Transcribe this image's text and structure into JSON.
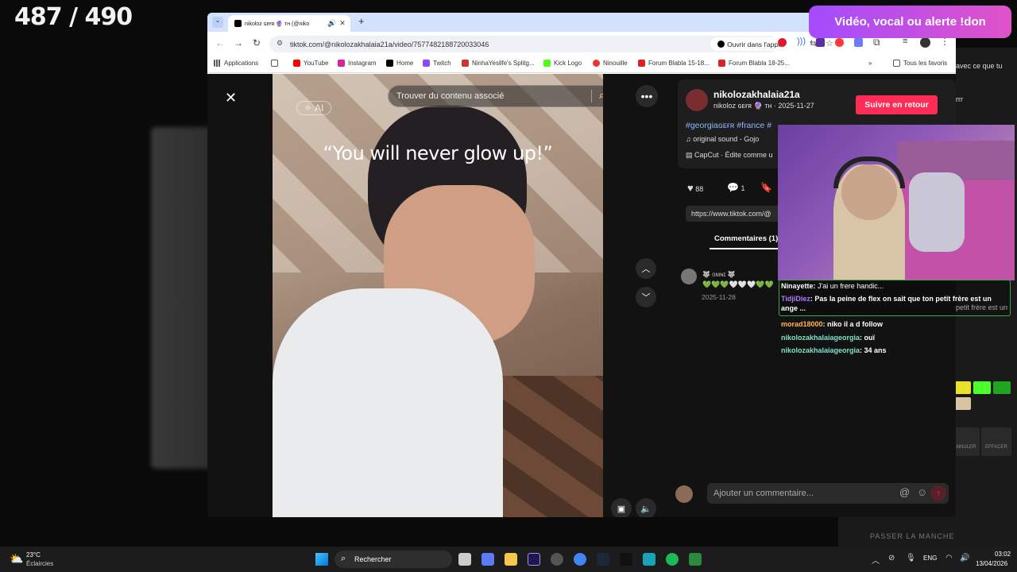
{
  "counter": "487 / 490",
  "alert": "Vidéo, vocal ou alerte !don",
  "browser": {
    "tab_title": "nikoloz ɢᴇғʀ 🔮 ᴛʜ (@niko",
    "url": "tiktok.com/@nikolozakhalaia21a/video/7577482188720033046",
    "open_app": "Ouvrir dans l'appli",
    "bookmarks": [
      "Applications",
      "YouTube",
      "Instagram",
      "Home",
      "Twitch",
      "NinhaYeslife's Splitg...",
      "Kick Logo",
      "Ninouille",
      "Forum Blabla 15-18...",
      "Forum Blabla 18-25...",
      "Tous les favoris"
    ]
  },
  "video": {
    "search_placeholder": "Trouver du contenu associé",
    "ai_badge": "AI",
    "caption": "“You will never glow up!”"
  },
  "post": {
    "username": "nikolozakhalaia21a",
    "subline": "nikoloz ɢᴇғʀ 🔮 ᴛʜ · 2025-11-27",
    "follow": "Suivre en retour",
    "hashtags": "#georgiaɢᴇғʀ #france #",
    "sound": "original sound - Gojo",
    "capcut": "CapCut · Édite comme u",
    "likes": "88",
    "comments_count": "1",
    "link": "https://www.tiktok.com/@",
    "comments_tab": "Commentaires (1)",
    "comment_user": "🐺 ᴏᴍɴɪ 🐺",
    "comment_text": "💚💚💚🤍🤍🤍💚💚",
    "comment_date": "2025-11-28",
    "add_comment": "Ajouter un commentaire..."
  },
  "chat": [
    {
      "user": "Ninayette",
      "text": "J'ai un frere handic...",
      "color": "#ffffff"
    },
    {
      "user": "TidjiDiez",
      "text": "Pas la peine de flex on sait que ton petit frère est un ange ...",
      "color": "#b07cff"
    },
    {
      "user": "morad18000",
      "text": "niko il a d follow",
      "color": "#ffb84d"
    },
    {
      "user": "nikolozakhalaiageorgia",
      "text": "ouï",
      "color": "#7fe3c9"
    },
    {
      "user": "nikolozakhalaiageorgia",
      "text": "34 ans",
      "color": "#7fe3c9"
    }
  ],
  "right_panel": {
    "t1": "avec ce que tu",
    "t2": "rrr",
    "t3": "petit frère est un",
    "bottom": "PASSER LA MANCHE"
  },
  "taskbar": {
    "weather_temp": "23°C",
    "weather_desc": "Éclaircies",
    "search": "Rechercher",
    "lang": "ENG",
    "time": "03:02",
    "date": "13/04/2026"
  }
}
